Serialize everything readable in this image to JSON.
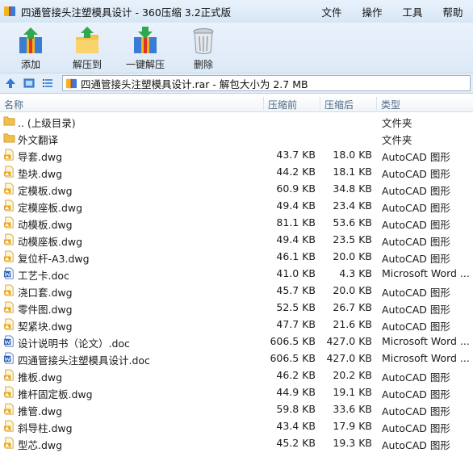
{
  "window": {
    "title": "四通管接头注塑模具设计 - 360压缩 3.2正式版",
    "menu": [
      "文件",
      "操作",
      "工具",
      "帮助"
    ]
  },
  "toolbar": {
    "buttons": [
      {
        "label": "添加",
        "icon": "add-archive-icon"
      },
      {
        "label": "解压到",
        "icon": "extract-to-icon"
      },
      {
        "label": "一键解压",
        "icon": "one-click-extract-icon"
      },
      {
        "label": "删除",
        "icon": "trash-icon"
      }
    ]
  },
  "address": {
    "path": "四通管接头注塑模具设计.rar - 解包大小为 2.7 MB"
  },
  "columns": {
    "name": "名称",
    "compressed": "压缩前",
    "original": "压缩后",
    "type": "类型"
  },
  "colors": {
    "folder": "#f2c04a",
    "dwg": "#e8a923",
    "doc": "#2b5fb3",
    "header_text": "#4f6b86",
    "toolbar_bg": "#dce9f6"
  },
  "files": [
    {
      "name": ".. (上级目录)",
      "comp": "",
      "orig": "",
      "type": "文件夹",
      "kind": "folder"
    },
    {
      "name": "外文翻译",
      "comp": "",
      "orig": "",
      "type": "文件夹",
      "kind": "folder"
    },
    {
      "name": "导套.dwg",
      "comp": "43.7 KB",
      "orig": "18.0 KB",
      "type": "AutoCAD 图形",
      "kind": "dwg"
    },
    {
      "name": "垫块.dwg",
      "comp": "44.2 KB",
      "orig": "18.1 KB",
      "type": "AutoCAD 图形",
      "kind": "dwg"
    },
    {
      "name": "定模板.dwg",
      "comp": "60.9 KB",
      "orig": "34.8 KB",
      "type": "AutoCAD 图形",
      "kind": "dwg"
    },
    {
      "name": "定模座板.dwg",
      "comp": "49.4 KB",
      "orig": "23.4 KB",
      "type": "AutoCAD 图形",
      "kind": "dwg"
    },
    {
      "name": "动模板.dwg",
      "comp": "81.1 KB",
      "orig": "53.6 KB",
      "type": "AutoCAD 图形",
      "kind": "dwg"
    },
    {
      "name": "动模座板.dwg",
      "comp": "49.4 KB",
      "orig": "23.5 KB",
      "type": "AutoCAD 图形",
      "kind": "dwg"
    },
    {
      "name": "复位杆-A3.dwg",
      "comp": "46.1 KB",
      "orig": "20.0 KB",
      "type": "AutoCAD 图形",
      "kind": "dwg"
    },
    {
      "name": "工艺卡.doc",
      "comp": "41.0 KB",
      "orig": "4.3 KB",
      "type": "Microsoft Word ...",
      "kind": "doc"
    },
    {
      "name": "浇口套.dwg",
      "comp": "45.7 KB",
      "orig": "20.0 KB",
      "type": "AutoCAD 图形",
      "kind": "dwg"
    },
    {
      "name": "零件图.dwg",
      "comp": "52.5 KB",
      "orig": "26.7 KB",
      "type": "AutoCAD 图形",
      "kind": "dwg"
    },
    {
      "name": "契紧块.dwg",
      "comp": "47.7 KB",
      "orig": "21.6 KB",
      "type": "AutoCAD 图形",
      "kind": "dwg"
    },
    {
      "name": "设计说明书（论文）.doc",
      "comp": "606.5 KB",
      "orig": "427.0 KB",
      "type": "Microsoft Word ...",
      "kind": "doc"
    },
    {
      "name": "四通管接头注塑模具设计.doc",
      "comp": "606.5 KB",
      "orig": "427.0 KB",
      "type": "Microsoft Word ...",
      "kind": "doc"
    },
    {
      "name": "推板.dwg",
      "comp": "46.2 KB",
      "orig": "20.2 KB",
      "type": "AutoCAD 图形",
      "kind": "dwg"
    },
    {
      "name": "推杆固定板.dwg",
      "comp": "44.9 KB",
      "orig": "19.1 KB",
      "type": "AutoCAD 图形",
      "kind": "dwg"
    },
    {
      "name": "推管.dwg",
      "comp": "59.8 KB",
      "orig": "33.6 KB",
      "type": "AutoCAD 图形",
      "kind": "dwg"
    },
    {
      "name": "斜导柱.dwg",
      "comp": "43.4 KB",
      "orig": "17.9 KB",
      "type": "AutoCAD 图形",
      "kind": "dwg"
    },
    {
      "name": "型芯.dwg",
      "comp": "45.2 KB",
      "orig": "19.3 KB",
      "type": "AutoCAD 图形",
      "kind": "dwg"
    }
  ]
}
